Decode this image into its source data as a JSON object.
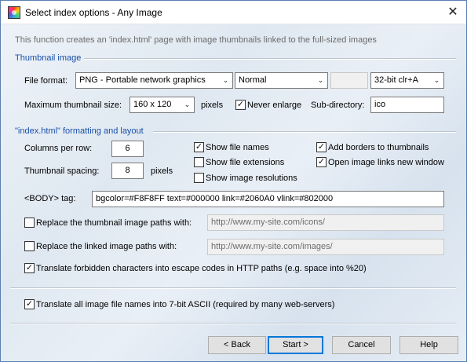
{
  "window": {
    "title": "Select index options - Any Image",
    "close_glyph": "✕"
  },
  "intro": "This function creates an 'index.html' page with image thumbnails linked to the full-sized images",
  "thumbnail": {
    "section_label": "Thumbnail image",
    "file_format_label": "File format:",
    "file_format_value": "PNG - Portable network graphics",
    "quality_value": "Normal",
    "color_depth_value": "32-bit clr+A",
    "max_size_label": "Maximum thumbnail size:",
    "max_size_value": "160 x 120",
    "pixels_label": "pixels",
    "never_enlarge_label": "Never enlarge",
    "never_enlarge_checked": true,
    "subdir_label": "Sub-directory:",
    "subdir_value": "ico"
  },
  "layout": {
    "section_label": "\"index.html\" formatting and layout",
    "columns_label": "Columns per row:",
    "columns_value": "6",
    "spacing_label": "Thumbnail spacing:",
    "spacing_value": "8",
    "pixels_label": "pixels",
    "show_file_names_label": "Show file names",
    "show_file_names_checked": true,
    "show_file_extensions_label": "Show file extensions",
    "show_file_extensions_checked": false,
    "show_image_resolutions_label": "Show image resolutions",
    "show_image_resolutions_checked": false,
    "add_borders_label": "Add borders to thumbnails",
    "add_borders_checked": true,
    "open_new_window_label": "Open image links new window",
    "open_new_window_checked": true,
    "body_tag_label": "<BODY> tag:",
    "body_tag_value": "bgcolor=#F8F8FF text=#000000 link=#2060A0 vlink=#802000",
    "replace_thumb_label": "Replace the thumbnail image paths with:",
    "replace_thumb_checked": false,
    "replace_thumb_value": "http://www.my-site.com/icons/",
    "replace_linked_label": "Replace the linked image paths with:",
    "replace_linked_checked": false,
    "replace_linked_value": "http://www.my-site.com/images/",
    "translate_forbidden_label": "Translate forbidden characters into escape codes in HTTP paths (e.g. space into %20)",
    "translate_forbidden_checked": true
  },
  "translate_ascii_label": "Translate all image file names into 7-bit ASCII (required by many web-servers)",
  "translate_ascii_checked": true,
  "buttons": {
    "back": "< Back",
    "start": "Start >",
    "cancel": "Cancel",
    "help": "Help"
  },
  "check_glyph": "✓",
  "dropdown_arrow_glyph": "⌄"
}
